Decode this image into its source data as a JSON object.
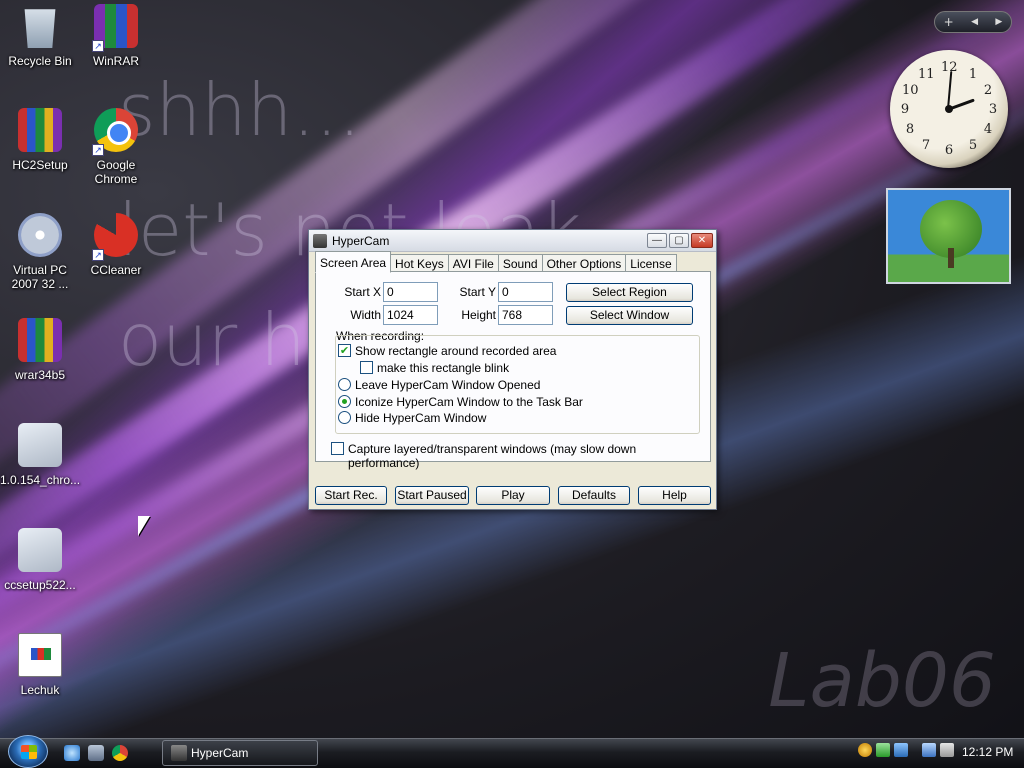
{
  "wallpaper": {
    "line1": "shhh...",
    "line2": "let's not leak",
    "line3": "our ha",
    "watermark": "Lab06"
  },
  "desktop_icons": [
    {
      "label": "Recycle Bin",
      "icon": "recycle-bin-icon"
    },
    {
      "label": "WinRAR",
      "icon": "winrar-icon"
    },
    {
      "label": "HC2Setup",
      "icon": "installer-icon"
    },
    {
      "label": "Google Chrome",
      "icon": "chrome-icon"
    },
    {
      "label": "Virtual PC 2007 32 ...",
      "icon": "virtual-pc-icon"
    },
    {
      "label": "CCleaner",
      "icon": "ccleaner-icon"
    },
    {
      "label": "wrar34b5",
      "icon": "winrar-installer-icon"
    },
    {
      "label": "1.0.154_chro...",
      "icon": "installer-icon"
    },
    {
      "label": "ccsetup522...",
      "icon": "installer-icon"
    },
    {
      "label": "Lechuk",
      "icon": "document-icon"
    }
  ],
  "gadgets": {
    "bar": {
      "add": "+",
      "prev": "◀",
      "next": "▶"
    },
    "clock_numbers": [
      "12",
      "1",
      "2",
      "3",
      "4",
      "5",
      "6",
      "7",
      "8",
      "9",
      "10",
      "11"
    ]
  },
  "window": {
    "title": "HyperCam",
    "controls": {
      "minimize": "—",
      "maximize": "▢",
      "close": "✕"
    },
    "tabs": [
      "Screen Area",
      "Hot Keys",
      "AVI File",
      "Sound",
      "Other Options",
      "License"
    ],
    "active_tab": "Screen Area",
    "fields": {
      "start_x_label": "Start X",
      "start_x": "0",
      "start_y_label": "Start Y",
      "start_y": "0",
      "width_label": "Width",
      "width": "1024",
      "height_label": "Height",
      "height": "768"
    },
    "select_region": "Select Region",
    "select_window": "Select Window",
    "when_recording": "When recording:",
    "options": {
      "show_rect": {
        "label": "Show rectangle around recorded area",
        "checked": true
      },
      "blink": {
        "label": "make this rectangle blink",
        "checked": false
      },
      "leave_open": {
        "label": "Leave HyperCam Window Opened",
        "selected": false
      },
      "iconize": {
        "label": "Iconize HyperCam Window to the Task Bar",
        "selected": true
      },
      "hide": {
        "label": "Hide HyperCam Window",
        "selected": false
      },
      "layered": {
        "label": "Capture layered/transparent windows (may slow down performance)",
        "checked": false
      }
    },
    "buttons": {
      "start_rec": "Start Rec.",
      "start_paused": "Start Paused",
      "play": "Play",
      "defaults": "Defaults",
      "help": "Help"
    }
  },
  "taskbar": {
    "task": "HyperCam",
    "time": "12:12 PM"
  },
  "colors": {
    "window_bg": "#ece9d8",
    "taskbar": "#1b1d22",
    "accent_purple": "#c86eff"
  }
}
